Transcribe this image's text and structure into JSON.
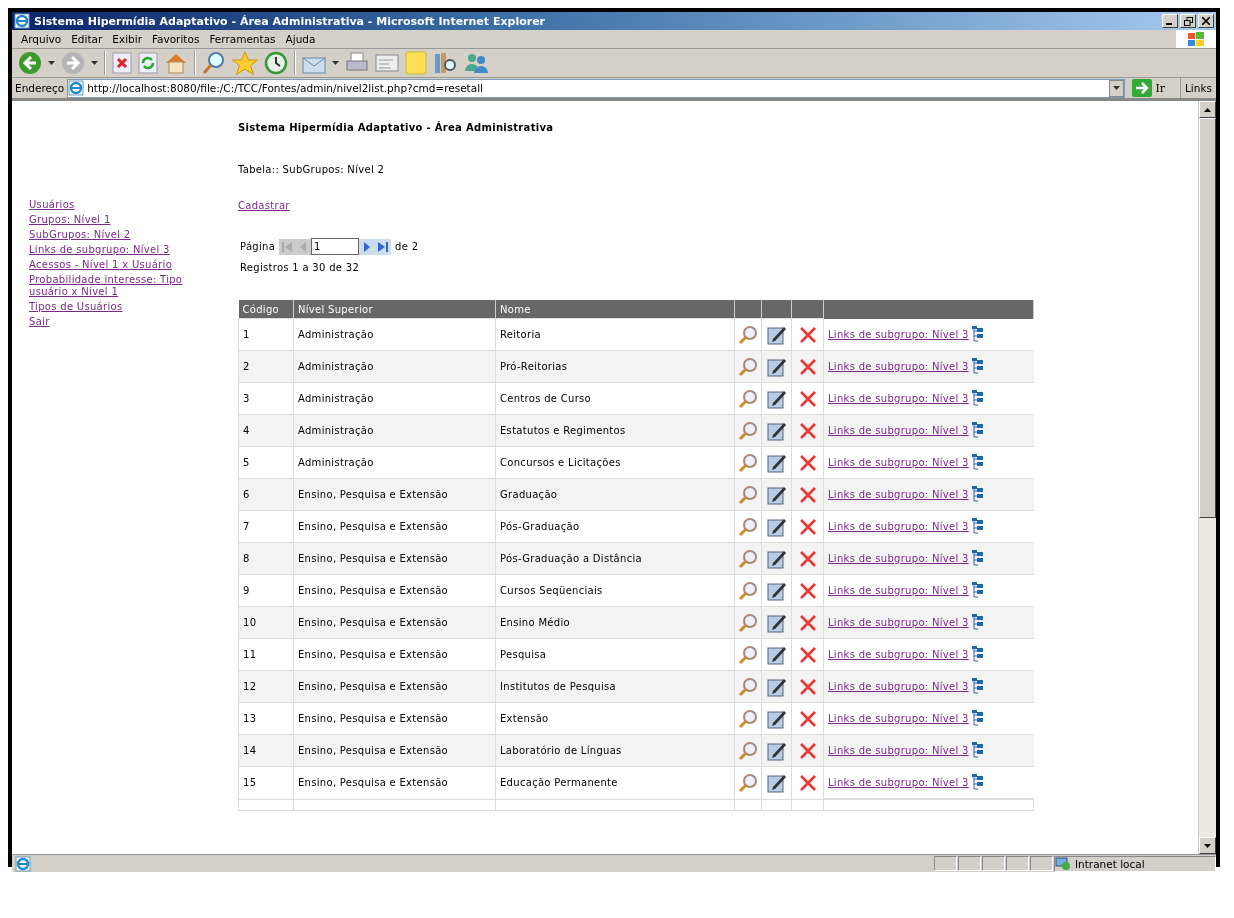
{
  "window": {
    "title": "Sistema Hipermídia Adaptativo - Área Administrativa - Microsoft Internet Explorer"
  },
  "menu": [
    "Arquivo",
    "Editar",
    "Exibir",
    "Favoritos",
    "Ferramentas",
    "Ajuda"
  ],
  "address_bar": {
    "label": "Endereço",
    "url": "http://localhost:8080/file:/C:/TCC/Fontes/admin/nivel2list.php?cmd=resetall",
    "go": "Ir",
    "links": "Links"
  },
  "page": {
    "heading": "Sistema Hipermídia Adaptativo - Área Administrativa",
    "sidebar": [
      "Usuários",
      "Grupos: Nível 1",
      "SubGrupos: Nível 2",
      "Links de subgrupo: Nível 3",
      "Acessos - Nível 1 x Usuário",
      "Probabilidade interesse: Tipo usuário x Nível 1",
      "Tipos de Usuários",
      "Sair"
    ],
    "table_label": "Tabela:: SubGrupos: Nível 2",
    "add_link": "Cadastrar",
    "pager": {
      "label": "Página",
      "value": "1",
      "of": "de 2",
      "buttons": [
        {
          "kind": "first",
          "disabled": true
        },
        {
          "kind": "prev",
          "disabled": true
        },
        {
          "kind": "next",
          "disabled": false
        },
        {
          "kind": "last",
          "disabled": false
        }
      ]
    },
    "records": "Registros 1 a 30 de 32",
    "table": {
      "columns": [
        "Código",
        "Nível Superior",
        "Nome"
      ],
      "rows": [
        {
          "code": "1",
          "parent": "Administração",
          "name": "Reitoria",
          "link": "Links de subgrupo: Nível 3"
        },
        {
          "code": "2",
          "parent": "Administração",
          "name": "Pró-Reitorias",
          "link": "Links de subgrupo: Nível 3"
        },
        {
          "code": "3",
          "parent": "Administração",
          "name": "Centros de Curso",
          "link": "Links de subgrupo: Nível 3"
        },
        {
          "code": "4",
          "parent": "Administração",
          "name": "Estatutos e Regimentos",
          "link": "Links de subgrupo: Nível 3"
        },
        {
          "code": "5",
          "parent": "Administração",
          "name": "Concursos e Licitações",
          "link": "Links de subgrupo: Nível 3"
        },
        {
          "code": "6",
          "parent": "Ensino, Pesquisa e Extensão",
          "name": "Graduação",
          "link": "Links de subgrupo: Nível 3"
        },
        {
          "code": "7",
          "parent": "Ensino, Pesquisa e Extensão",
          "name": "Pós-Graduação",
          "link": "Links de subgrupo: Nível 3"
        },
        {
          "code": "8",
          "parent": "Ensino, Pesquisa e Extensão",
          "name": "Pós-Graduação a Distância",
          "link": "Links de subgrupo: Nível 3"
        },
        {
          "code": "9",
          "parent": "Ensino, Pesquisa e Extensão",
          "name": "Cursos Seqüenciais",
          "link": "Links de subgrupo: Nível 3"
        },
        {
          "code": "10",
          "parent": "Ensino, Pesquisa e Extensão",
          "name": "Ensino Médio",
          "link": "Links de subgrupo: Nível 3"
        },
        {
          "code": "11",
          "parent": "Ensino, Pesquisa e Extensão",
          "name": "Pesquisa",
          "link": "Links de subgrupo: Nível 3"
        },
        {
          "code": "12",
          "parent": "Ensino, Pesquisa e Extensão",
          "name": "Institutos de Pesquisa",
          "link": "Links de subgrupo: Nível 3"
        },
        {
          "code": "13",
          "parent": "Ensino, Pesquisa e Extensão",
          "name": "Extensão",
          "link": "Links de subgrupo: Nível 3"
        },
        {
          "code": "14",
          "parent": "Ensino, Pesquisa e Extensão",
          "name": "Laboratório de Línguas",
          "link": "Links de subgrupo: Nível 3"
        },
        {
          "code": "15",
          "parent": "Ensino, Pesquisa e Extensão",
          "name": "Educação Permanente",
          "link": "Links de subgrupo: Nível 3"
        }
      ]
    }
  },
  "status_bar": {
    "zone": "Intranet local"
  }
}
